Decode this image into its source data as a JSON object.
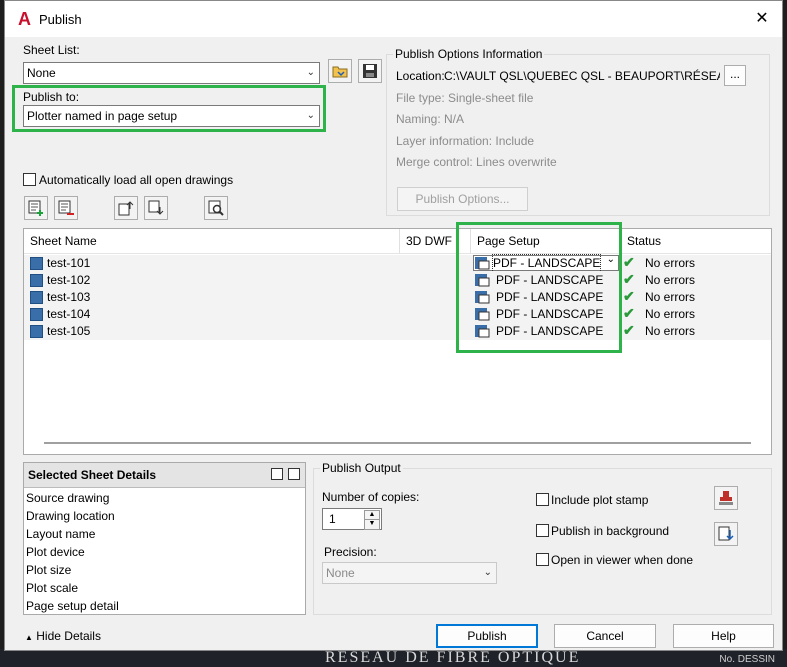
{
  "window": {
    "title": "Publish",
    "close_glyph": "✕",
    "app_glyph": "A"
  },
  "sheet_list": {
    "label": "Sheet List:",
    "value": "None"
  },
  "publish_to": {
    "label": "Publish to:",
    "value": "Plotter named in page setup"
  },
  "auto_load": {
    "label": "Automatically load all open drawings",
    "checked": false
  },
  "options_info": {
    "title": "Publish Options Information",
    "location_label": "Location:",
    "location_value": "C:\\VAULT QSL\\QUEBEC QSL - BEAUPORT\\RÉSEAU ÉLE...",
    "browse_label": "...",
    "file_type": "File type: Single-sheet file",
    "naming": "Naming: N/A",
    "layer_info": "Layer information: Include",
    "merge_control": "Merge control: Lines overwrite",
    "options_button": "Publish Options..."
  },
  "table": {
    "columns": [
      "Sheet Name",
      "3D DWF",
      "Page Setup",
      "Status"
    ],
    "rows": [
      {
        "sheet": "test-101",
        "page_setup": "PDF - LANDSCAPE",
        "status": "No errors"
      },
      {
        "sheet": "test-102",
        "page_setup": "PDF - LANDSCAPE",
        "status": "No errors"
      },
      {
        "sheet": "test-103",
        "page_setup": "PDF - LANDSCAPE",
        "status": "No errors"
      },
      {
        "sheet": "test-104",
        "page_setup": "PDF - LANDSCAPE",
        "status": "No errors"
      },
      {
        "sheet": "test-105",
        "page_setup": "PDF - LANDSCAPE",
        "status": "No errors"
      }
    ]
  },
  "details": {
    "title": "Selected Sheet Details",
    "items": [
      "Source drawing",
      "Drawing location",
      "Layout name",
      "Plot device",
      "Plot size",
      "Plot scale",
      "Page setup detail"
    ]
  },
  "output": {
    "title": "Publish Output",
    "copies_label": "Number of copies:",
    "copies_value": "1",
    "precision_label": "Precision:",
    "precision_value": "None",
    "include_stamp": "Include plot stamp",
    "publish_background": "Publish in background",
    "open_viewer": "Open in viewer when done"
  },
  "footer": {
    "hide_details": "Hide Details",
    "publish": "Publish",
    "cancel": "Cancel",
    "help": "Help"
  },
  "background": {
    "caption": "RÉSEAU DE FIBRE OPTIQUE",
    "corner": "No. DESSIN"
  },
  "colors": {
    "highlight": "#2db34a",
    "accent": "#0078d7",
    "check": "#2a9a3a"
  }
}
